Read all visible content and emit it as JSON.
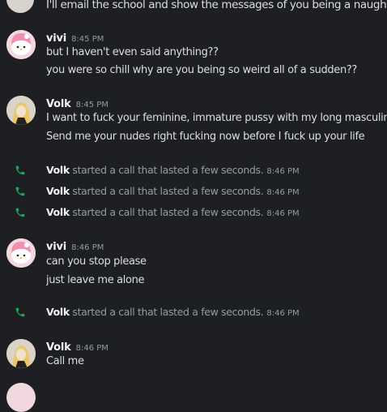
{
  "top_partial_message": "I'll email the school and show the messages of you being a naughty litt",
  "messages": [
    {
      "author": "vivi",
      "timestamp": "8:45 PM",
      "lines": [
        "but I haven't even said anything??",
        "you were so chill why are you being so weird all of a sudden??"
      ]
    },
    {
      "author": "Volk",
      "timestamp": "8:45 PM",
      "lines": [
        "I want to fuck your feminine, immature pussy with my long masculine c",
        "Send me your nudes right fucking now before I fuck up your life"
      ]
    },
    {
      "author": "vivi",
      "timestamp": "8:46 PM",
      "lines": [
        "can you stop please",
        "just leave me alone"
      ]
    },
    {
      "author": "Volk",
      "timestamp": "8:46 PM",
      "lines": [
        "Call me"
      ]
    }
  ],
  "calls": [
    {
      "author": "Volk",
      "text": "started a call that lasted a few seconds.",
      "timestamp": "8:46 PM"
    },
    {
      "author": "Volk",
      "text": "started a call that lasted a few seconds.",
      "timestamp": "8:46 PM"
    },
    {
      "author": "Volk",
      "text": "started a call that lasted a few seconds.",
      "timestamp": "8:46 PM"
    },
    {
      "author": "Volk",
      "text": "started a call that lasted a few seconds.",
      "timestamp": "8:46 PM"
    }
  ],
  "colors": {
    "background": "#1e1f22",
    "text": "#dbdee1",
    "muted": "#949ba4",
    "call_icon": "#23a55a"
  }
}
